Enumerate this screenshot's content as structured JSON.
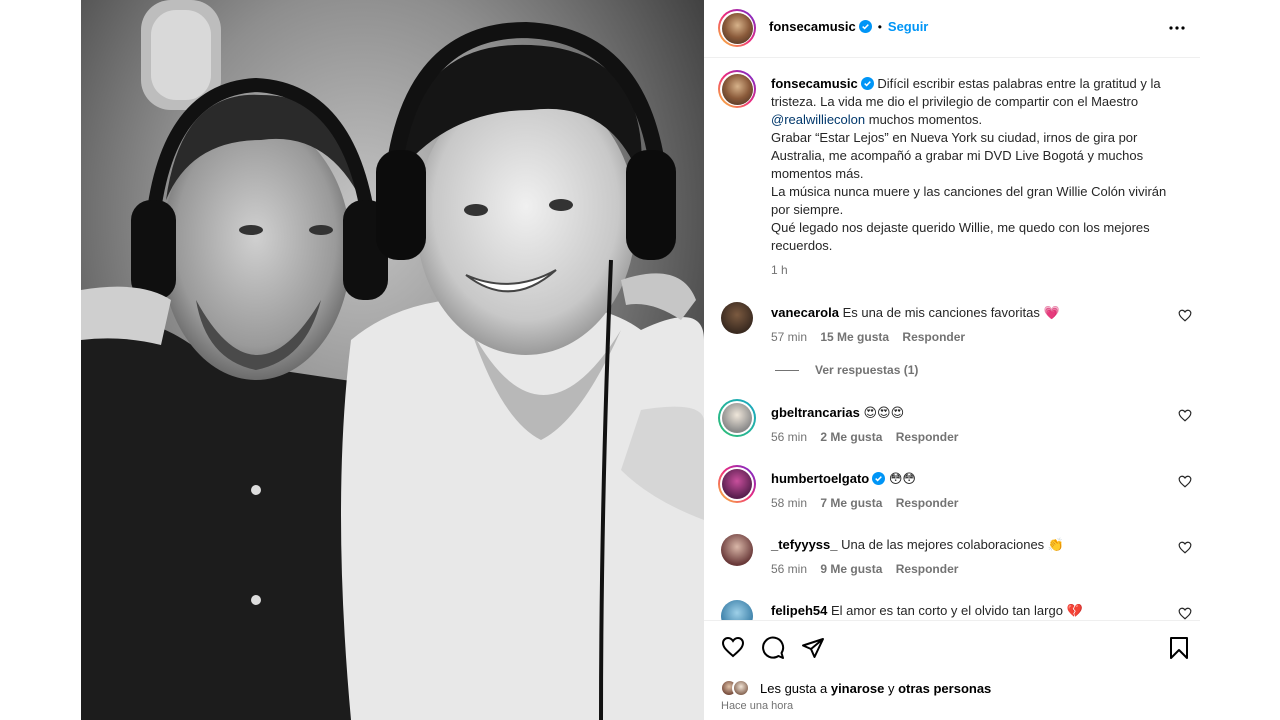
{
  "post": {
    "author": "fonsecamusic",
    "follow_label": "Seguir",
    "dot": "•",
    "caption": {
      "lead": "Difícil escribir estas palabras entre la gratitud y la tristeza. La vida me dio el privilegio de compartir con el Maestro ",
      "mention": "@realwilliecolon",
      "line1_tail": " muchos momentos.",
      "line2": "Grabar “Estar Lejos” en Nueva York su ciudad, irnos de gira por Australia, me acompañó a grabar mi DVD Live Bogotá y muchos momentos más.",
      "line3": "La música nunca muere y las canciones del gran Willie Colón vivirán por siempre.",
      "line4": "Qué legado nos dejaste querido Willie, me quedo con los mejores recuerdos.",
      "time": "1 h"
    },
    "comments": [
      {
        "user": "vanecarola",
        "text": "Es una de mis canciones favoritas 💗",
        "time": "57 min",
        "likes": "15 Me gusta",
        "reply": "Responder"
      },
      {
        "user": "gbeltrancarias",
        "text": "😍😍😍",
        "time": "56 min",
        "likes": "2 Me gusta",
        "reply": "Responder"
      },
      {
        "user": "humbertoelgato",
        "text": "😳😳",
        "time": "58 min",
        "likes": "7 Me gusta",
        "reply": "Responder"
      },
      {
        "user": "_tefyyyss_",
        "text": "Una de las mejores colaboraciones 👏",
        "time": "56 min",
        "likes": "9 Me gusta",
        "reply": "Responder"
      },
      {
        "user": "felipeh54",
        "text": "El amor es tan corto y el olvido tan largo 💔"
      }
    ],
    "view_replies": "Ver respuestas (1)",
    "likes": {
      "prefix": "Les gusta a ",
      "user": "yinarose",
      "middle": " y ",
      "others": "otras personas"
    },
    "time_ago": "Hace una hora"
  },
  "colors": {
    "accent": "#0095f6",
    "link": "#00376b",
    "muted": "#737373",
    "verified": "#0095f6"
  }
}
